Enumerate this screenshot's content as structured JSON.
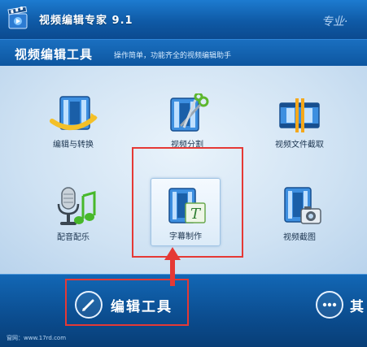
{
  "window": {
    "title": "视频编辑专家 9.1",
    "slogan": "专业·"
  },
  "header": {
    "title": "视频编辑工具",
    "subtitle": "操作简单，功能齐全的视频编辑助手"
  },
  "tools": [
    {
      "label": "编辑与转换",
      "icon": "film-convert-icon"
    },
    {
      "label": "视频分割",
      "icon": "film-scissors-icon"
    },
    {
      "label": "视频文件截取",
      "icon": "film-trim-icon"
    },
    {
      "label": "配音配乐",
      "icon": "microphone-music-icon"
    },
    {
      "label": "字幕制作",
      "icon": "film-subtitle-icon"
    },
    {
      "label": "视频截图",
      "icon": "film-camera-icon"
    }
  ],
  "bottom_nav": {
    "edit_tools": "编辑工具",
    "other": "其"
  },
  "footer": {
    "url": "窗网：www.17rd.com"
  },
  "colors": {
    "highlight": "#e53935",
    "title_bar": "#0f5aa6",
    "content_bg": "#d7e7f5"
  }
}
